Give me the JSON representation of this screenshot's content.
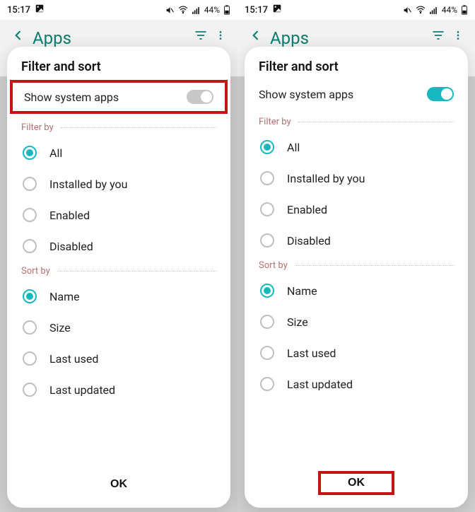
{
  "screens": [
    {
      "status": {
        "time": "15:17",
        "battery": "44%"
      },
      "page_title": "Apps",
      "sheet": {
        "title": "Filter and sort",
        "toggle": {
          "label": "Show system apps",
          "on": false,
          "highlight": true
        },
        "filter_header": "Filter by",
        "filter_options": [
          {
            "label": "All",
            "selected": true
          },
          {
            "label": "Installed by you",
            "selected": false
          },
          {
            "label": "Enabled",
            "selected": false
          },
          {
            "label": "Disabled",
            "selected": false
          }
        ],
        "sort_header": "Sort by",
        "sort_options": [
          {
            "label": "Name",
            "selected": true
          },
          {
            "label": "Size",
            "selected": false
          },
          {
            "label": "Last used",
            "selected": false
          },
          {
            "label": "Last updated",
            "selected": false
          }
        ],
        "ok_label": "OK",
        "ok_highlight": false
      }
    },
    {
      "status": {
        "time": "15:17",
        "battery": "44%"
      },
      "page_title": "Apps",
      "sheet": {
        "title": "Filter and sort",
        "toggle": {
          "label": "Show system apps",
          "on": true,
          "highlight": false
        },
        "filter_header": "Filter by",
        "filter_options": [
          {
            "label": "All",
            "selected": true
          },
          {
            "label": "Installed by you",
            "selected": false
          },
          {
            "label": "Enabled",
            "selected": false
          },
          {
            "label": "Disabled",
            "selected": false
          }
        ],
        "sort_header": "Sort by",
        "sort_options": [
          {
            "label": "Name",
            "selected": true
          },
          {
            "label": "Size",
            "selected": false
          },
          {
            "label": "Last used",
            "selected": false
          },
          {
            "label": "Last updated",
            "selected": false
          }
        ],
        "ok_label": "OK",
        "ok_highlight": true
      }
    }
  ]
}
